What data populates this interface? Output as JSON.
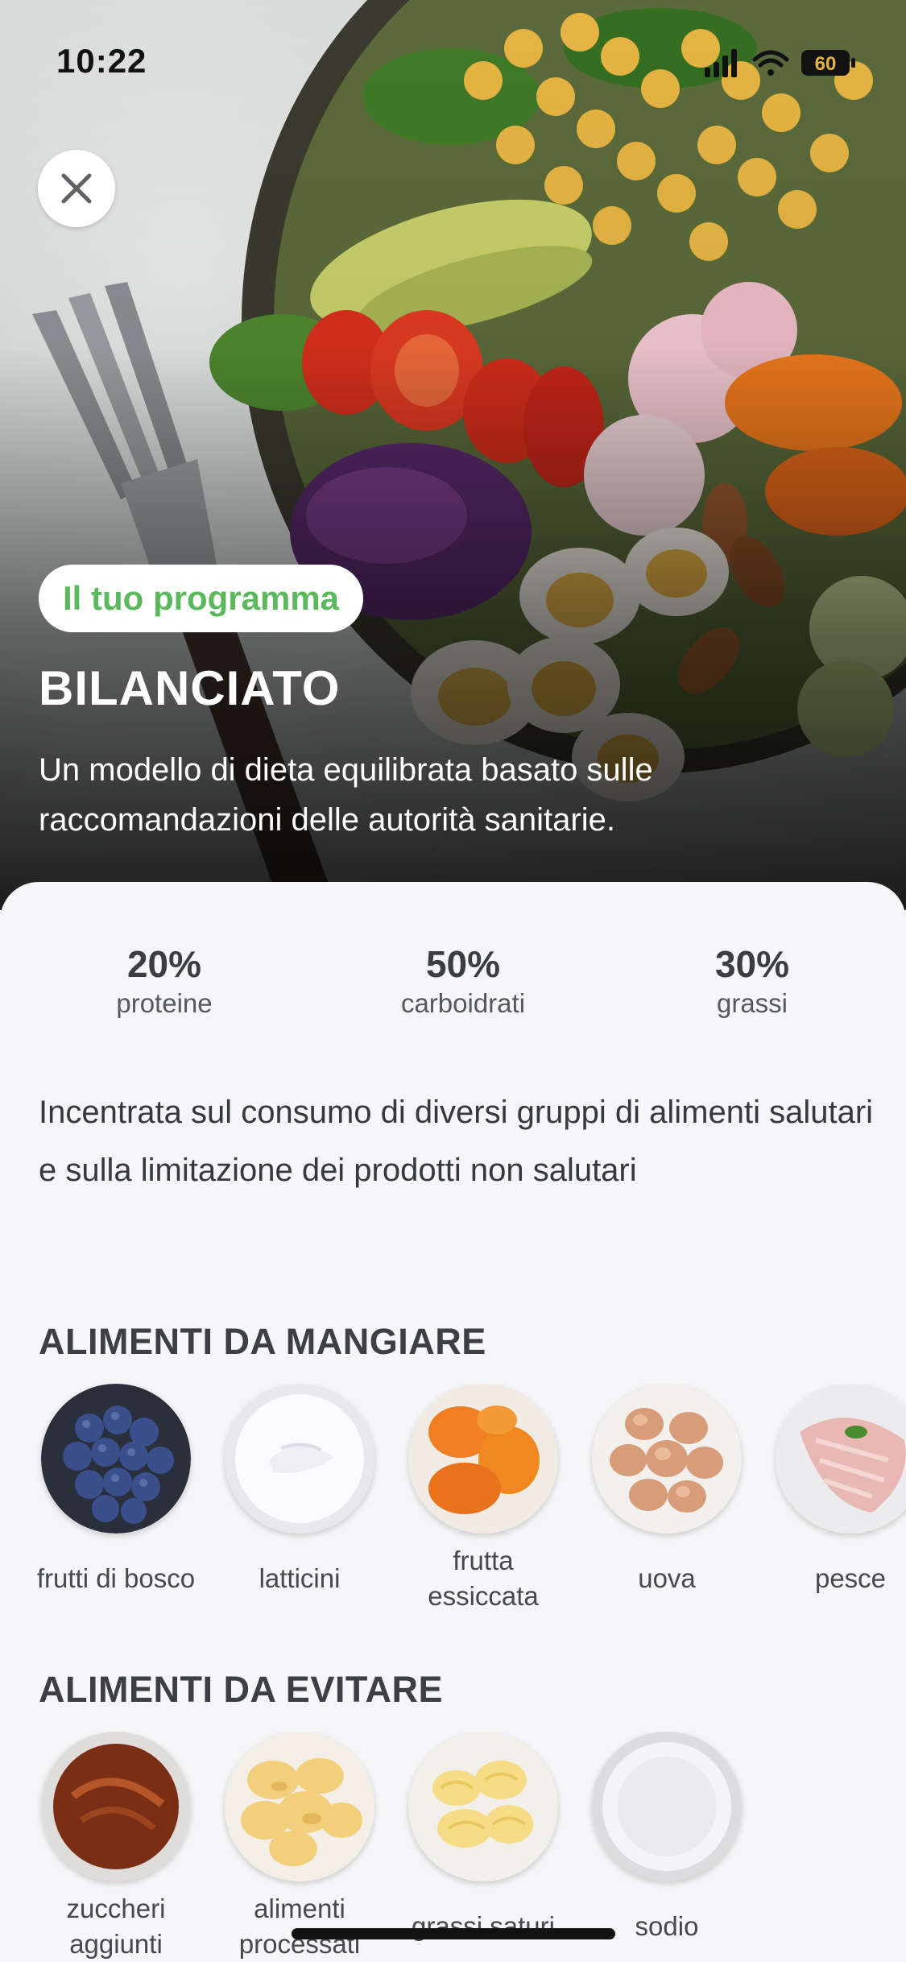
{
  "status_bar": {
    "time": "10:22",
    "battery": "60",
    "icons": [
      "cellular-signal-icon",
      "wifi-icon",
      "battery-icon"
    ]
  },
  "hero": {
    "close_icon": "close-icon",
    "pill_label": "Il tuo programma",
    "title": "BILANCIATO",
    "description": "Un modello di dieta equilibrata basato sulle raccomandazioni delle autorità sanitarie."
  },
  "macros": [
    {
      "value": "20%",
      "label": "proteine"
    },
    {
      "value": "50%",
      "label": "carboidrati"
    },
    {
      "value": "30%",
      "label": "grassi"
    }
  ],
  "intro": "Incentrata sul consumo di diversi gruppi di alimenti salutari e sulla limitazione dei prodotti non salutari",
  "eat": {
    "title": "ALIMENTI DA MANGIARE",
    "items": [
      {
        "label": "frutti di bosco",
        "image": "blueberries"
      },
      {
        "label": "latticini",
        "image": "yogurt"
      },
      {
        "label": "frutta essiccata",
        "image": "dried-apricots"
      },
      {
        "label": "uova",
        "image": "eggs"
      },
      {
        "label": "pesce",
        "image": "fish-fillet"
      }
    ]
  },
  "avoid": {
    "title": "ALIMENTI DA EVITARE",
    "items": [
      {
        "label": "zuccheri aggiunti",
        "image": "caramel-sauce"
      },
      {
        "label": "alimenti processati",
        "image": "potato-chips"
      },
      {
        "label": "grassi saturi",
        "image": "butter-curls"
      },
      {
        "label": "sodio",
        "image": "salt"
      }
    ]
  },
  "colors": {
    "accent_green": "#5bb85d",
    "sheet_background": "#f6f6f8",
    "text_dark": "#3a3d42"
  }
}
